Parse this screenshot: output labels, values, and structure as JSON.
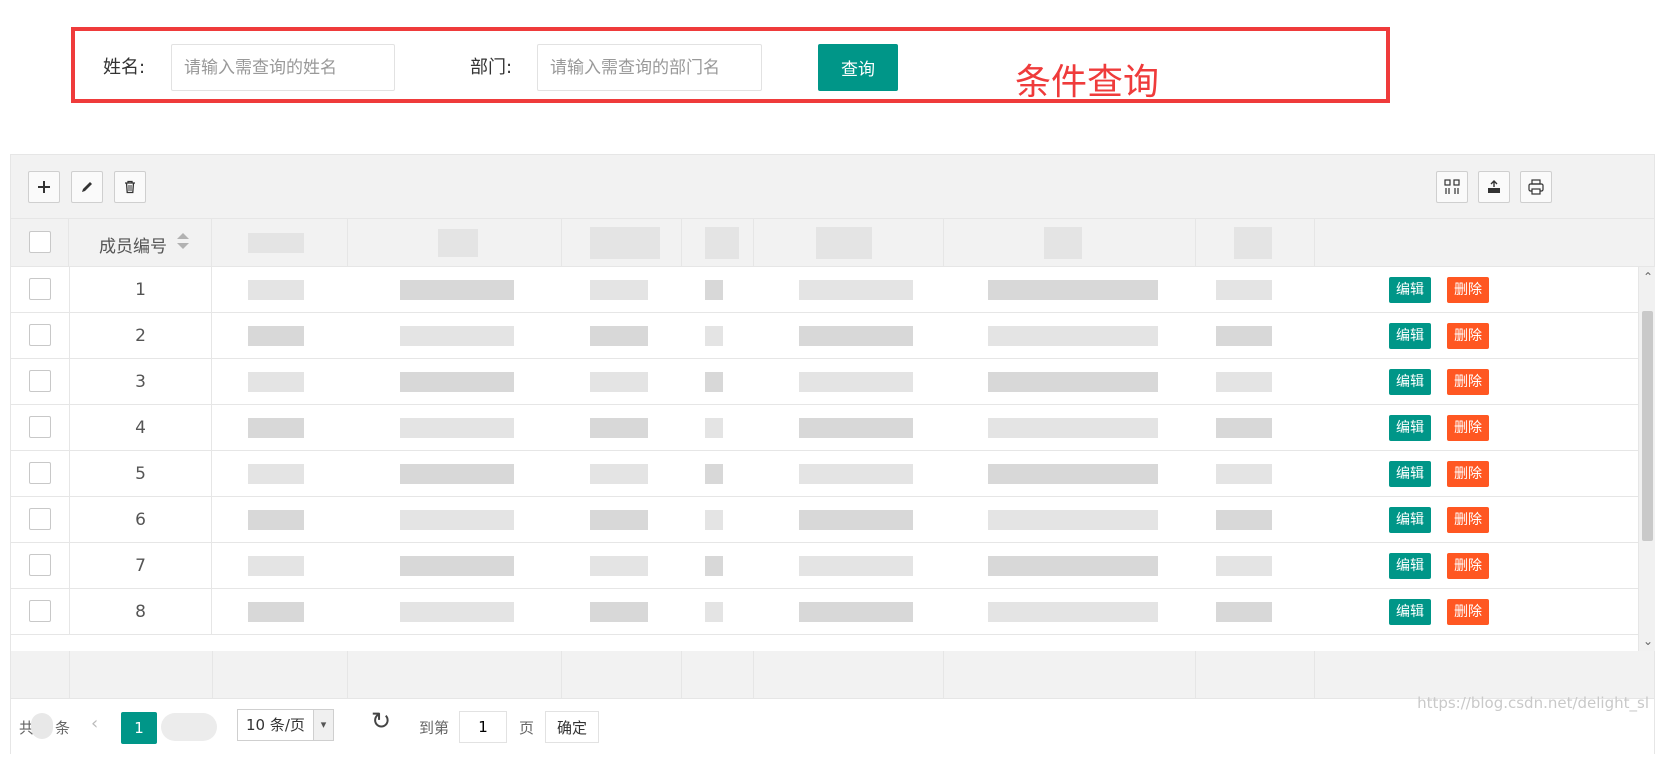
{
  "search": {
    "name_label": "姓名:",
    "name_placeholder": "请输入需查询的姓名",
    "dept_label": "部门:",
    "dept_placeholder": "请输入需查询的部门名",
    "query_button": "查询",
    "annotation": "条件查询"
  },
  "toolbar": {
    "add_icon": "plus-icon",
    "edit_icon": "pencil-icon",
    "delete_icon": "trash-icon",
    "columns_icon": "columns-icon",
    "export_icon": "export-icon",
    "print_icon": "print-icon"
  },
  "table": {
    "id_header": "成员编号",
    "rows": [
      "1",
      "2",
      "3",
      "4",
      "5",
      "6",
      "7",
      "8"
    ],
    "edit_label": "编辑",
    "delete_label": "删除"
  },
  "pager": {
    "total_prefix": "共",
    "total_suffix": "条",
    "current_page": "1",
    "page_size": "10 条/页",
    "goto_label": "到第",
    "goto_value": "1",
    "page_label": "页",
    "confirm_label": "确定"
  },
  "watermark": "https://blog.csdn.net/delight_sl",
  "colors": {
    "primary": "#009688",
    "danger": "#ff5722",
    "annotation": "#ef3b3b"
  }
}
